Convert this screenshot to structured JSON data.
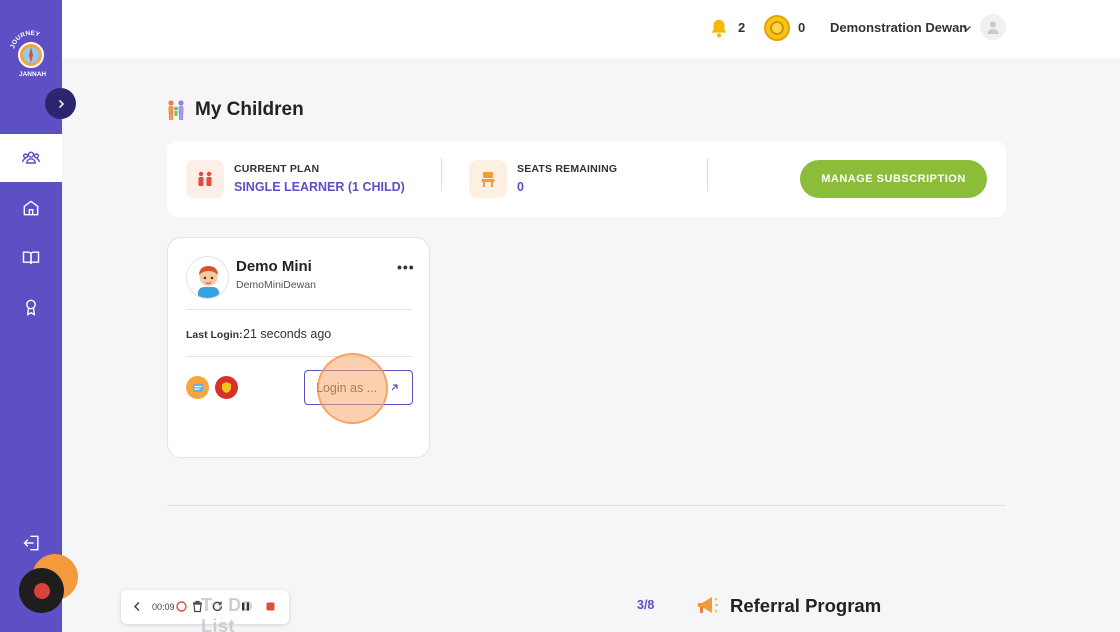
{
  "sidebar": {
    "logo_text": "JOURNEY JANNAH",
    "items": [
      {
        "icon": "users-icon",
        "active": true
      },
      {
        "icon": "home-icon",
        "active": false
      },
      {
        "icon": "book-icon",
        "active": false
      },
      {
        "icon": "award-icon",
        "active": false
      }
    ],
    "bottom_icon": "logout-icon"
  },
  "header": {
    "notifications_count": "2",
    "coins_count": "0",
    "user_name": "Demonstration Dewan"
  },
  "page": {
    "title": "My Children"
  },
  "plan": {
    "current_plan_label": "CURRENT PLAN",
    "current_plan_value": "SINGLE LEARNER (1 CHILD)",
    "seats_label": "SEATS REMAINING",
    "seats_value": "0",
    "manage_button": "MANAGE SUBSCRIPTION"
  },
  "child": {
    "name": "Demo Mini",
    "username": "DemoMiniDewan",
    "last_login_label": "Last Login:",
    "last_login_value": "21 seconds ago",
    "login_button": "Login as ..."
  },
  "recorder": {
    "time": "00:09",
    "watermark": "To Do List"
  },
  "referral": {
    "pager": "3/8",
    "title": "Referral Program"
  },
  "colors": {
    "brand": "#5d4fc4",
    "accent_green": "#8bbd38",
    "sidebar_dark": "#2e2570"
  }
}
